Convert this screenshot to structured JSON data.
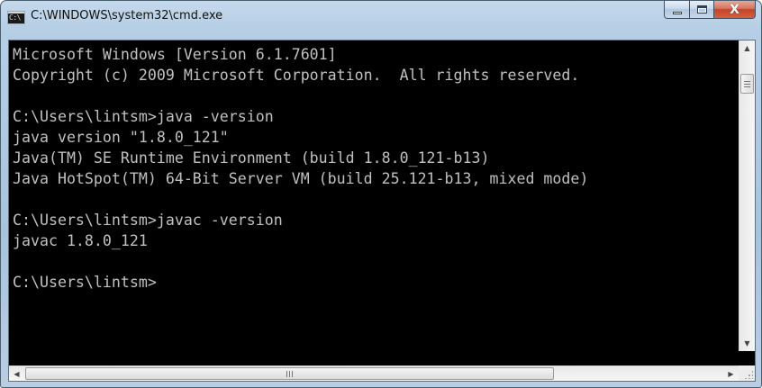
{
  "window": {
    "title": "C:\\WINDOWS\\system32\\cmd.exe",
    "icon": "cmd-app-icon",
    "icon_text": "C:\\",
    "buttons": {
      "minimize_icon": "minimize-icon",
      "maximize_icon": "maximize-icon",
      "close_icon": "close-icon",
      "close_glyph": "X"
    }
  },
  "console": {
    "background": "#000000",
    "foreground": "#c0c0c0",
    "lines": [
      "Microsoft Windows [Version 6.1.7601]",
      "Copyright (c) 2009 Microsoft Corporation.  All rights reserved.",
      "",
      "C:\\Users\\lintsm>java -version",
      "java version \"1.8.0_121\"",
      "Java(TM) SE Runtime Environment (build 1.8.0_121-b13)",
      "Java HotSpot(TM) 64-Bit Server VM (build 25.121-b13, mixed mode)",
      "",
      "C:\\Users\\lintsm>javac -version",
      "javac 1.8.0_121",
      "",
      "C:\\Users\\lintsm>"
    ]
  },
  "scrollbars": {
    "vertical": {
      "up_arrow": "▲",
      "down_arrow": "▼"
    },
    "horizontal": {
      "left_arrow": "◀",
      "right_arrow": "▶"
    }
  }
}
